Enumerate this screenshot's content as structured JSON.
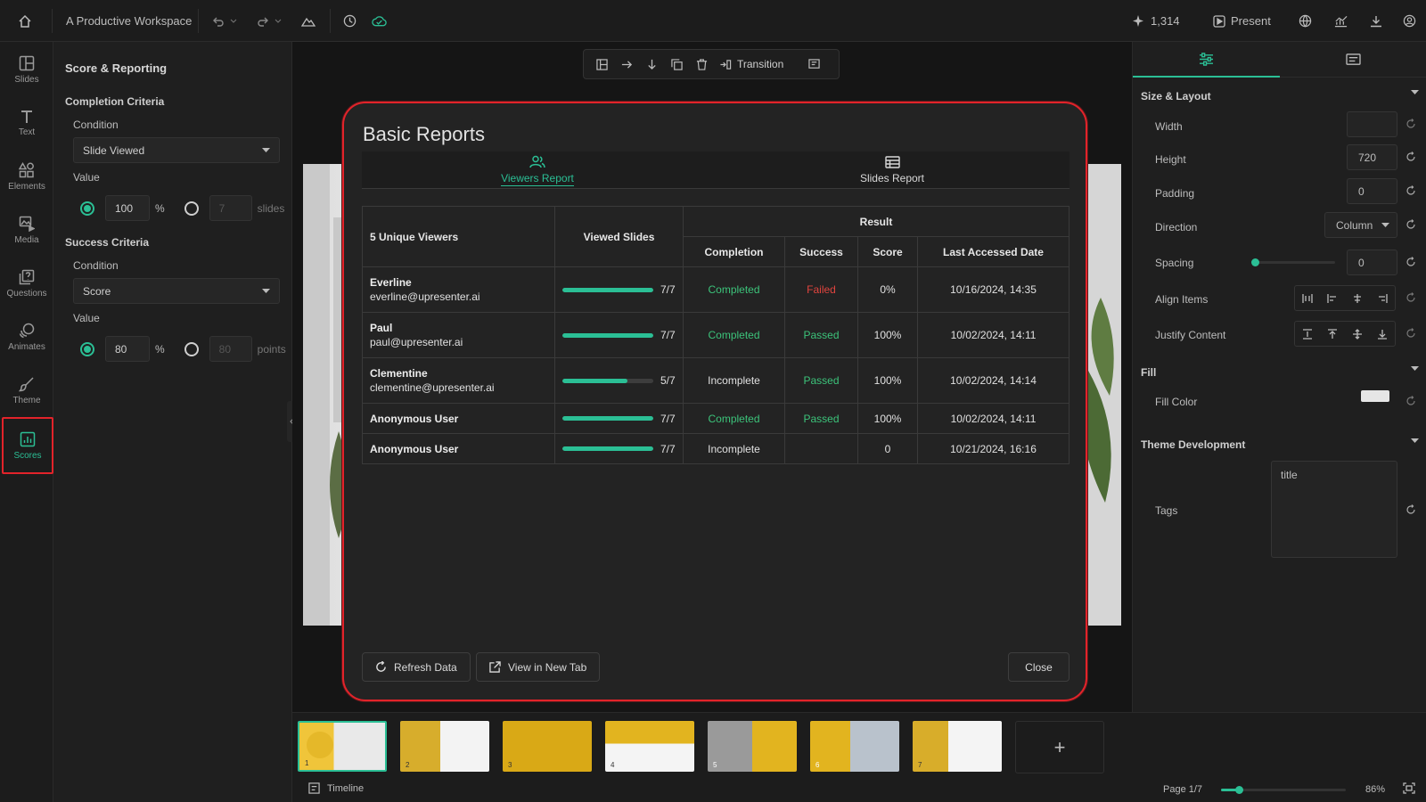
{
  "topbar": {
    "title": "A Productive Workspace",
    "credits": "1,314",
    "present_label": "Present"
  },
  "left_rail": {
    "items": [
      {
        "label": "Slides",
        "icon": "slides-icon"
      },
      {
        "label": "Text",
        "icon": "text-icon"
      },
      {
        "label": "Elements",
        "icon": "elements-icon"
      },
      {
        "label": "Media",
        "icon": "media-icon"
      },
      {
        "label": "Questions",
        "icon": "questions-icon"
      },
      {
        "label": "Animates",
        "icon": "animates-icon"
      },
      {
        "label": "Theme",
        "icon": "theme-icon"
      },
      {
        "label": "Scores",
        "icon": "scores-icon"
      }
    ]
  },
  "left_panel": {
    "title": "Score & Reporting",
    "completion": {
      "heading": "Completion Criteria",
      "condition_label": "Condition",
      "condition_value": "Slide Viewed",
      "value_label": "Value",
      "percent_value": "100",
      "percent_unit": "%",
      "count_value": "7",
      "count_unit": "slides"
    },
    "success": {
      "heading": "Success Criteria",
      "condition_label": "Condition",
      "condition_value": "Score",
      "value_label": "Value",
      "percent_value": "80",
      "percent_unit": "%",
      "count_value": "80",
      "count_unit": "points"
    }
  },
  "toolbar": {
    "transition_label": "Transition"
  },
  "modal": {
    "title": "Basic Reports",
    "tabs": [
      {
        "label": "Viewers Report"
      },
      {
        "label": "Slides Report"
      }
    ],
    "table": {
      "viewers_header": "5 Unique Viewers",
      "viewed_header": "Viewed Slides",
      "result_header": "Result",
      "sub_headers": [
        "Completion",
        "Success",
        "Score",
        "Last Accessed Date"
      ],
      "rows": [
        {
          "name": "Everline",
          "email": "everline@upresenter.ai",
          "viewed": "7/7",
          "progress": 1.0,
          "completion": "Completed",
          "success": "Failed",
          "score": "0%",
          "date": "10/16/2024, 14:35"
        },
        {
          "name": "Paul",
          "email": "paul@upresenter.ai",
          "viewed": "7/7",
          "progress": 1.0,
          "completion": "Completed",
          "success": "Passed",
          "score": "100%",
          "date": "10/02/2024, 14:11"
        },
        {
          "name": "Clementine",
          "email": "clementine@upresenter.ai",
          "viewed": "5/7",
          "progress": 0.714,
          "completion": "Incomplete",
          "success": "Passed",
          "score": "100%",
          "date": "10/02/2024, 14:14"
        },
        {
          "name": "Anonymous User",
          "email": "",
          "viewed": "7/7",
          "progress": 1.0,
          "completion": "Completed",
          "success": "Passed",
          "score": "100%",
          "date": "10/02/2024, 14:11"
        },
        {
          "name": "Anonymous User",
          "email": "",
          "viewed": "7/7",
          "progress": 1.0,
          "completion": "Incomplete",
          "success": "",
          "score": "0",
          "date": "10/21/2024, 16:16"
        }
      ]
    },
    "buttons": {
      "refresh": "Refresh Data",
      "new_tab": "View in New Tab",
      "close": "Close"
    }
  },
  "right_panel": {
    "size_layout": {
      "heading": "Size & Layout",
      "width_label": "Width",
      "width_value": "",
      "height_label": "Height",
      "height_value": "720",
      "padding_label": "Padding",
      "padding_value": "0",
      "direction_label": "Direction",
      "direction_value": "Column",
      "spacing_label": "Spacing",
      "spacing_value": "0",
      "align_label": "Align Items",
      "justify_label": "Justify Content"
    },
    "fill": {
      "heading": "Fill",
      "color_label": "Fill Color",
      "color_value": "#e6e6e6"
    },
    "theme_dev": {
      "heading": "Theme Development",
      "tags_label": "Tags",
      "tags_value": "title"
    }
  },
  "bottom": {
    "timeline_label": "Timeline",
    "page_label": "Page 1/7",
    "zoom": "86%",
    "zoom_level": 0.14,
    "thumbs": [
      "1",
      "2",
      "3",
      "4",
      "5",
      "6",
      "7"
    ]
  },
  "colors": {
    "accent": "#2bbf95",
    "highlight": "#e2232a",
    "passed": "#3cc37a",
    "failed": "#e0443e"
  }
}
